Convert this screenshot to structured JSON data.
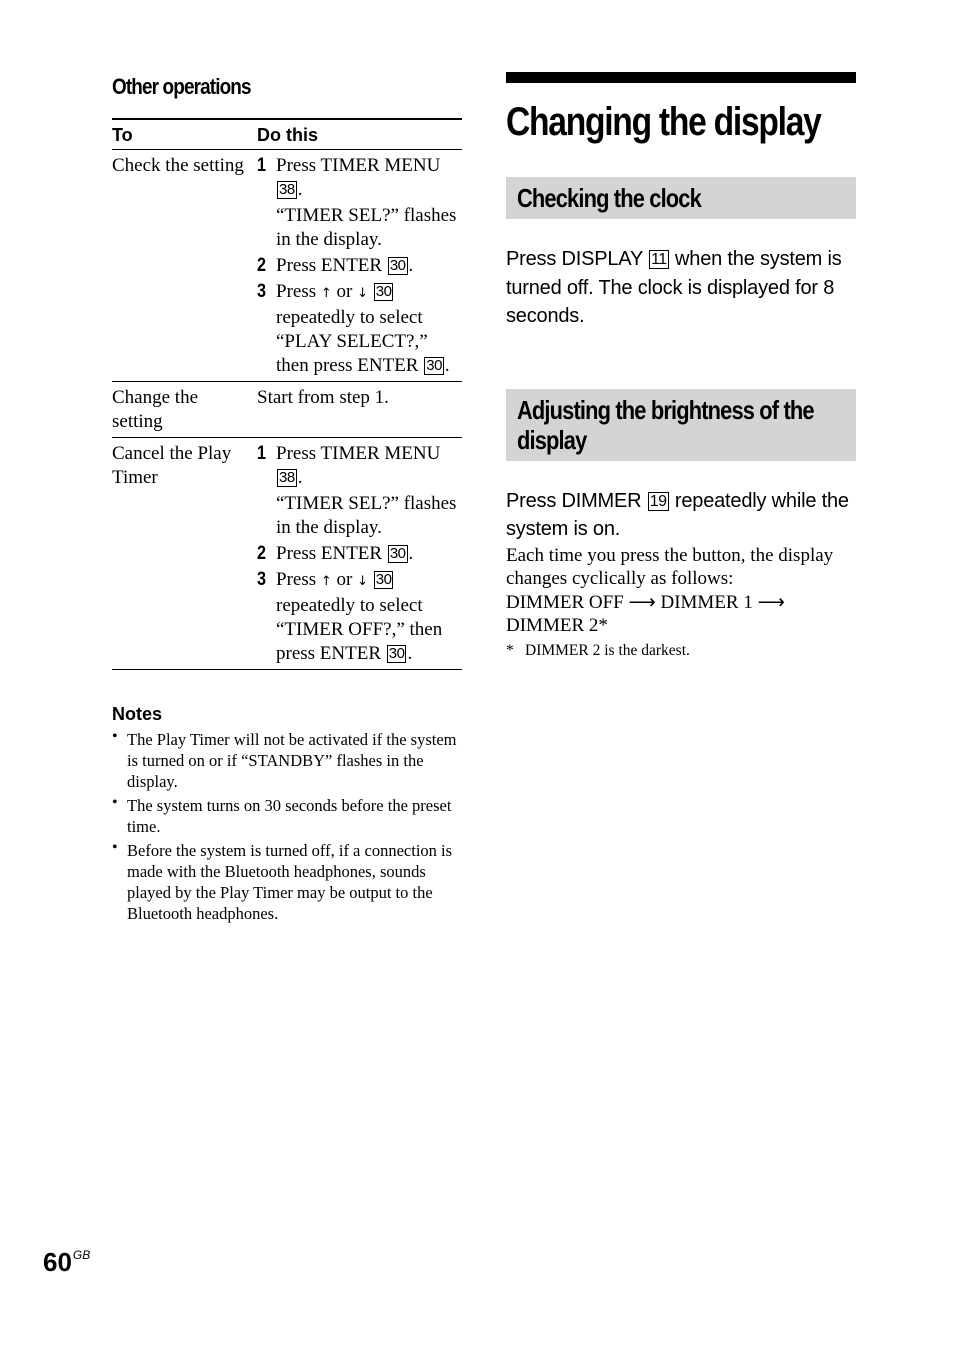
{
  "left": {
    "heading": "Other operations",
    "table": {
      "headers": [
        "To",
        "Do this"
      ],
      "rows": [
        {
          "to": "Check the setting",
          "steps": [
            {
              "num": "1",
              "lines": [
                {
                  "text": "Press TIMER MENU",
                  "key": "38",
                  "suffix": "."
                },
                {
                  "text": "“TIMER SEL?” flashes in the display."
                }
              ]
            },
            {
              "num": "2",
              "lines": [
                {
                  "text": "Press ENTER",
                  "key": "30",
                  "suffix": "."
                }
              ]
            },
            {
              "num": "3",
              "lines": [
                {
                  "text": "Press",
                  "up": "↑",
                  "or": "or",
                  "down": "↓",
                  "key": "30"
                },
                {
                  "text": "repeatedly to select “PLAY SELECT?,” then press ENTER",
                  "key": "30",
                  "suffix": "."
                }
              ]
            }
          ]
        },
        {
          "to": "Change the setting",
          "plain": "Start from step 1."
        },
        {
          "to": "Cancel the Play Timer",
          "steps": [
            {
              "num": "1",
              "lines": [
                {
                  "text": "Press TIMER MENU",
                  "key": "38",
                  "suffix": "."
                },
                {
                  "text": "“TIMER SEL?” flashes in the display."
                }
              ]
            },
            {
              "num": "2",
              "lines": [
                {
                  "text": "Press ENTER",
                  "key": "30",
                  "suffix": "."
                }
              ]
            },
            {
              "num": "3",
              "lines": [
                {
                  "text": "Press",
                  "up": "↑",
                  "or": "or",
                  "down": "↓",
                  "key": "30"
                },
                {
                  "text": "repeatedly to select “TIMER OFF?,” then press ENTER",
                  "key": "30",
                  "suffix": "."
                }
              ]
            }
          ]
        }
      ]
    },
    "notes": {
      "title": "Notes",
      "bullet": "•",
      "items": [
        "The Play Timer will not be activated if the system is turned on or if “STANDBY” flashes in the display.",
        "The system turns on 30 seconds before the preset time.",
        "Before the system is turned off, if a connection is made with the Bluetooth headphones, sounds played by the Play Timer may be output to the Bluetooth headphones."
      ]
    }
  },
  "right": {
    "title": "Changing the display",
    "sections": [
      {
        "heading": "Checking the clock",
        "lead_before": "Press DISPLAY",
        "lead_key": "11",
        "lead_after": "when the system is turned off. The clock is displayed for 8 seconds."
      },
      {
        "heading": "Adjusting the brightness of the display",
        "lead_before": "Press DIMMER",
        "lead_key": "19",
        "lead_after": "repeatedly while the system is on.",
        "body": "Each time you press the button, the display changes cyclically as follows:",
        "cycle": [
          "DIMMER OFF",
          "DIMMER 1",
          "DIMMER 2*"
        ],
        "cycle_arrow": "⟶",
        "footnote_star": "*",
        "footnote": "DIMMER 2 is the darkest."
      }
    ]
  },
  "footer": {
    "page_number": "60",
    "region": "GB"
  }
}
